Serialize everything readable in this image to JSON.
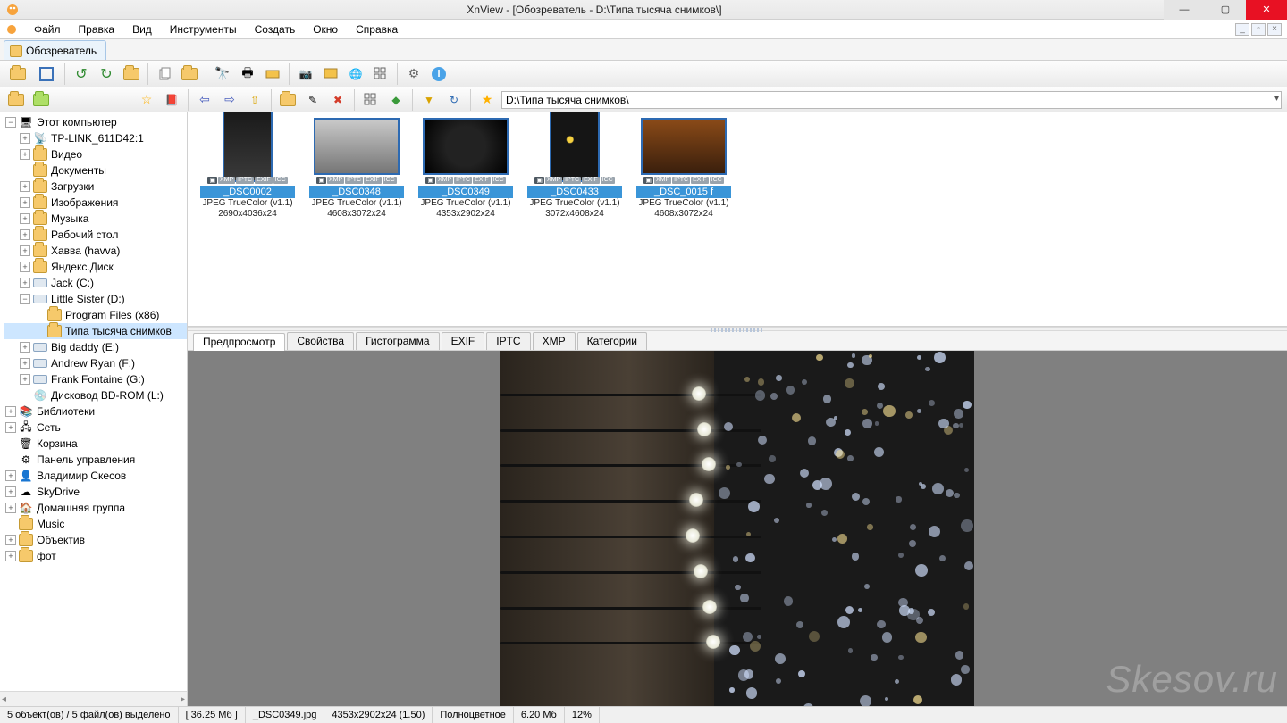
{
  "title": "XnView - [Обозреватель - D:\\Типа тысяча снимков\\]",
  "menu": {
    "file": "Файл",
    "edit": "Правка",
    "view": "Вид",
    "tools": "Инструменты",
    "create": "Создать",
    "window": "Окно",
    "help": "Справка"
  },
  "workspace_tab": "Обозреватель",
  "address_path": "D:\\Типа тысяча снимков\\",
  "tree": [
    {
      "lvl": 0,
      "exp": "-",
      "icon": "computer",
      "label": "Этот компьютер"
    },
    {
      "lvl": 1,
      "exp": "+",
      "icon": "net",
      "label": "TP-LINK_611D42:1"
    },
    {
      "lvl": 1,
      "exp": "+",
      "icon": "folder",
      "label": "Видео"
    },
    {
      "lvl": 1,
      "exp": " ",
      "icon": "folder",
      "label": "Документы"
    },
    {
      "lvl": 1,
      "exp": "+",
      "icon": "folder",
      "label": "Загрузки"
    },
    {
      "lvl": 1,
      "exp": "+",
      "icon": "folder",
      "label": "Изображения"
    },
    {
      "lvl": 1,
      "exp": "+",
      "icon": "folder",
      "label": "Музыка"
    },
    {
      "lvl": 1,
      "exp": "+",
      "icon": "folder",
      "label": "Рабочий стол"
    },
    {
      "lvl": 1,
      "exp": "+",
      "icon": "folder",
      "label": "Хавва (havva)"
    },
    {
      "lvl": 1,
      "exp": "+",
      "icon": "folder",
      "label": "Яндекс.Диск"
    },
    {
      "lvl": 1,
      "exp": "+",
      "icon": "disk",
      "label": "Jack (C:)"
    },
    {
      "lvl": 1,
      "exp": "-",
      "icon": "disk",
      "label": "Little Sister (D:)"
    },
    {
      "lvl": 2,
      "exp": " ",
      "icon": "folder",
      "label": "Program Files (x86)"
    },
    {
      "lvl": 2,
      "exp": " ",
      "icon": "folder",
      "label": "Типа тысяча снимков",
      "sel": true
    },
    {
      "lvl": 1,
      "exp": "+",
      "icon": "disk",
      "label": "Big daddy (E:)"
    },
    {
      "lvl": 1,
      "exp": "+",
      "icon": "disk",
      "label": "Andrew Ryan (F:)"
    },
    {
      "lvl": 1,
      "exp": "+",
      "icon": "disk",
      "label": "Frank Fontaine (G:)"
    },
    {
      "lvl": 1,
      "exp": " ",
      "icon": "cd",
      "label": "Дисковод BD-ROM (L:)"
    },
    {
      "lvl": 0,
      "exp": "+",
      "icon": "lib",
      "label": "Библиотеки"
    },
    {
      "lvl": 0,
      "exp": "+",
      "icon": "network",
      "label": "Сеть"
    },
    {
      "lvl": 0,
      "exp": " ",
      "icon": "bin",
      "label": "Корзина"
    },
    {
      "lvl": 0,
      "exp": " ",
      "icon": "control",
      "label": "Панель управления"
    },
    {
      "lvl": 0,
      "exp": "+",
      "icon": "user",
      "label": "Владимир Скесов"
    },
    {
      "lvl": 0,
      "exp": "+",
      "icon": "sky",
      "label": "SkyDrive"
    },
    {
      "lvl": 0,
      "exp": "+",
      "icon": "home",
      "label": "Домашняя группа"
    },
    {
      "lvl": 0,
      "exp": " ",
      "icon": "folder",
      "label": "Music"
    },
    {
      "lvl": 0,
      "exp": "+",
      "icon": "folder",
      "label": "Объектив"
    },
    {
      "lvl": 0,
      "exp": "+",
      "icon": "folder",
      "label": "фот"
    }
  ],
  "thumbs": [
    {
      "name": "_DSC0002",
      "type": "JPEG TrueColor (v1.1)",
      "dim": "2690x4036x24",
      "portrait": true
    },
    {
      "name": "_DSC0348",
      "type": "JPEG TrueColor (v1.1)",
      "dim": "4608x3072x24",
      "portrait": false
    },
    {
      "name": "_DSC0349",
      "type": "JPEG TrueColor (v1.1)",
      "dim": "4353x2902x24",
      "portrait": false
    },
    {
      "name": "_DSC0433",
      "type": "JPEG TrueColor (v1.1)",
      "dim": "3072x4608x24",
      "portrait": true
    },
    {
      "name": "_DSC_0015 f",
      "type": "JPEG TrueColor (v1.1)",
      "dim": "4608x3072x24",
      "portrait": false
    }
  ],
  "badges": [
    "▣",
    "XMP",
    "IPTC",
    "EXIF",
    "ICC"
  ],
  "preview_tabs": {
    "preview": "Предпросмотр",
    "props": "Свойства",
    "hist": "Гистограмма",
    "exif": "EXIF",
    "iptc": "IPTC",
    "xmp": "XMP",
    "cat": "Категории"
  },
  "watermark": "Skesov.ru",
  "status": {
    "selection": "5 объект(ов) / 5 файл(ов) выделено",
    "total": "[ 36.25 Мб ]",
    "filename": "_DSC0349.jpg",
    "dims": "4353x2902x24 (1.50)",
    "color": "Полноцветное",
    "size": "6.20 Мб",
    "zoom": "12%"
  }
}
